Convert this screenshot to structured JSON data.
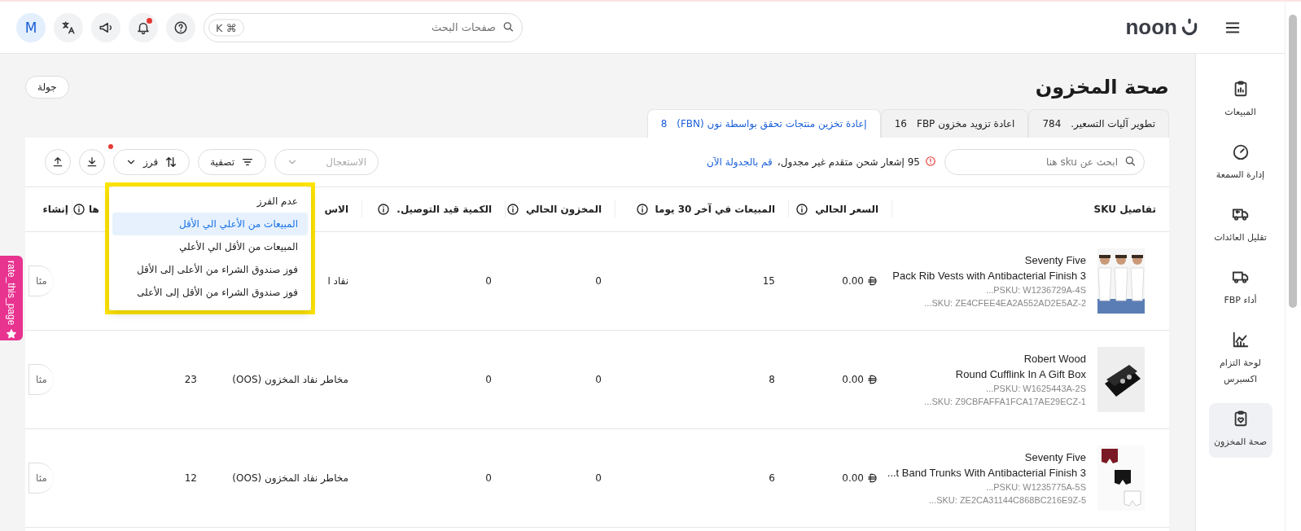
{
  "topbar": {
    "avatar": "M",
    "has_unread": true,
    "search_placeholder": "صفحات البحث",
    "shortcut": [
      "⌘",
      "K"
    ],
    "logo": "noon"
  },
  "sidebar": {
    "items": [
      {
        "label": "المبيعات",
        "selected": false
      },
      {
        "label": "إدارة السمعة",
        "selected": false
      },
      {
        "label": "تقليل العائدات",
        "selected": false
      },
      {
        "label": "أداء FBP",
        "selected": false
      },
      {
        "label": "لوحة التزام اكسبرس",
        "selected": false
      },
      {
        "label": "صحة المخزون",
        "selected": true
      }
    ]
  },
  "page": {
    "title": "صحة المخزون",
    "tour_button": "جولة"
  },
  "tabs": [
    {
      "label": "تطوير آليات التسعير.",
      "count": "784",
      "selected": false
    },
    {
      "label": "اعادة تزويد مخزون FBP",
      "count": "16",
      "selected": false
    },
    {
      "label": "إعادة تخزين منتجات تحقق بواسطة نون (FBN)",
      "count": "8",
      "selected": true
    }
  ],
  "toolbar": {
    "search_placeholder": "ابحث عن sku هنا",
    "notice": "95 إشعار شحن متقدم غير مجدول،",
    "notice_link": "قم بالجدولة الآن",
    "urgency_placeholder": "الاستعجال",
    "filter": "تصفية",
    "sort": "فرز",
    "sort_badge": true
  },
  "sort_menu": {
    "items": [
      {
        "label": "عدم الفرز",
        "selected": false
      },
      {
        "label": "المبيعات من الأعلي الي الأقل",
        "selected": true
      },
      {
        "label": "المبيعات من الأقل الي الأعلي",
        "selected": false
      },
      {
        "label": "فوز صندوق الشراء من الأعلى إلى الأقل",
        "selected": false
      },
      {
        "label": "فوز صندوق الشراء من الأقل إلى الأعلى",
        "selected": false
      }
    ]
  },
  "rate_tab": {
    "label": "rate_this_page"
  },
  "table": {
    "columns": [
      {
        "label": "تفاصيل SKU",
        "info": false
      },
      {
        "label": "السعر الحالي",
        "info": true
      },
      {
        "label": "المبيعات في آخر 30 يوما",
        "info": true
      },
      {
        "label": "المخزون الحالي",
        "info": true
      },
      {
        "label": "الكمية قيد التوصيل.",
        "info": true
      },
      {
        "label": "الاس",
        "info": false
      },
      {
        "label": "ها",
        "info": true
      },
      {
        "label": "إنشاء",
        "info": false
      }
    ],
    "rows": [
      {
        "brand": "Seventy Five",
        "title": "Pack Rib Vests with Antibacterial Finish 3",
        "psku": "...PSKU: W1236729A-4S",
        "sku": "...SKU: ZE4CFEE4EA2A552AD2E5AZ-2",
        "kind": "picture",
        "price": "0.00",
        "sales": "15",
        "stock": "0",
        "transit": "0",
        "risk": "نفاد ا",
        "action": "مثا"
      },
      {
        "brand": "Robert Wood",
        "title": "Round Cufflink In A Gift Box",
        "psku": "...PSKU: W1625443A-2S",
        "sku": "...SKU: Z9CBFAFFA1FCA17AE29ECZ-1",
        "kind": "picture",
        "price": "0.00",
        "sales": "8",
        "stock": "0",
        "transit": "0",
        "risk": "مخاطر نفاد المخزون (OOS)",
        "days": "23",
        "action": "مثا"
      },
      {
        "brand": "Seventy Five",
        "title": "...t Band Trunks With Antibacterial Finish 3",
        "psku": "...PSKU: W1235775A-5S",
        "sku": "...SKU: ZE2CA31144C868BC216E9Z-5",
        "kind": "picture",
        "price": "0.00",
        "sales": "6",
        "stock": "0",
        "transit": "0",
        "risk": "مخاطر نفاد المخزون (OOS)",
        "days": "12",
        "action": "مثا"
      }
    ]
  }
}
